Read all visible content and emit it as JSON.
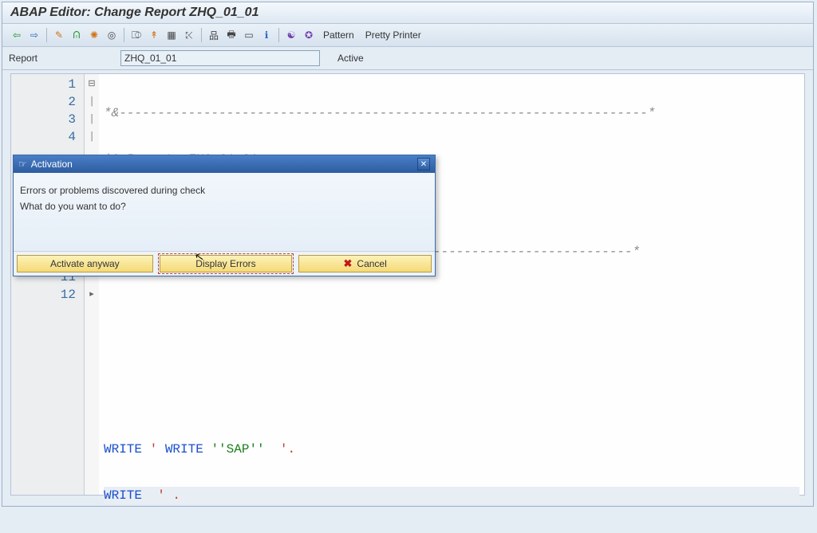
{
  "header": {
    "title": "ABAP Editor: Change Report ZHQ_01_01"
  },
  "toolbar": {
    "pattern": "Pattern",
    "pretty": "Pretty Printer"
  },
  "subbar": {
    "label": "Report",
    "value": "ZHQ_01_01",
    "status": "Active"
  },
  "editor": {
    "lines": {
      "l1": "1",
      "l2": "2",
      "l3": "3",
      "l4": "4",
      "l11": "11",
      "l12": "12"
    },
    "code": {
      "r1_prefix": "*&",
      "r1_dash": "---------------------------------------------------------------------*",
      "r2_prefix": "*& Report",
      "r2_name": "  ZHQ_01_01",
      "r3": "*&",
      "r4_tail": "---------------------------------------------------------------------*",
      "r11_kw": "WRITE",
      "r11_mid_pre": " ' ",
      "r11_mid_kw": "WRITE",
      "r11_mid_str": " ''SAP''",
      "r11_mid_post": "  '.",
      "r12_kw": "WRITE",
      "r12_tail": "  ' ."
    }
  },
  "dialog": {
    "title": "Activation",
    "line1": "Errors or problems discovered during check",
    "line2": "What do you want to do?",
    "btn_activate": "Activate anyway",
    "btn_display": "Display Errors",
    "btn_cancel": "Cancel"
  }
}
